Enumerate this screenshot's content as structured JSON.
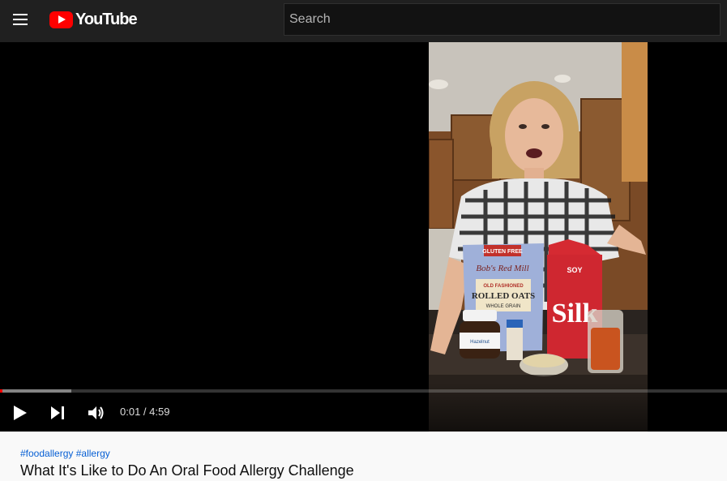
{
  "header": {
    "logo_text": "YouTube",
    "search_placeholder": "Search",
    "menu_icon": "hamburger-menu-icon",
    "logo_icon": "youtube-play-logo-icon",
    "logo_color": "#ff0000"
  },
  "player": {
    "current_time": "0:01",
    "duration": "4:59",
    "time_display": "0:01 / 4:59",
    "progress_played_fraction": 0.0033,
    "progress_buffered_fraction": 0.098,
    "progress_color": "#ff0000",
    "controls": {
      "play_icon": "play-icon",
      "next_icon": "next-icon",
      "volume_icon": "volume-icon"
    }
  },
  "video": {
    "hashtags": [
      "#foodallergy",
      "#allergy"
    ],
    "title": "What It's Like to Do An Oral Food Allergy Challenge"
  },
  "product_labels": {
    "bag_brand": "Bob's Red Mill",
    "bag_top": "GLUTEN FREE",
    "bag_line1": "OLD FASHIONED",
    "bag_line2": "ROLLED OATS",
    "bag_line3": "WHOLE GRAIN",
    "carton_top": "SOY",
    "carton_brand": "Silk",
    "jar_label": "Hazelnut"
  }
}
